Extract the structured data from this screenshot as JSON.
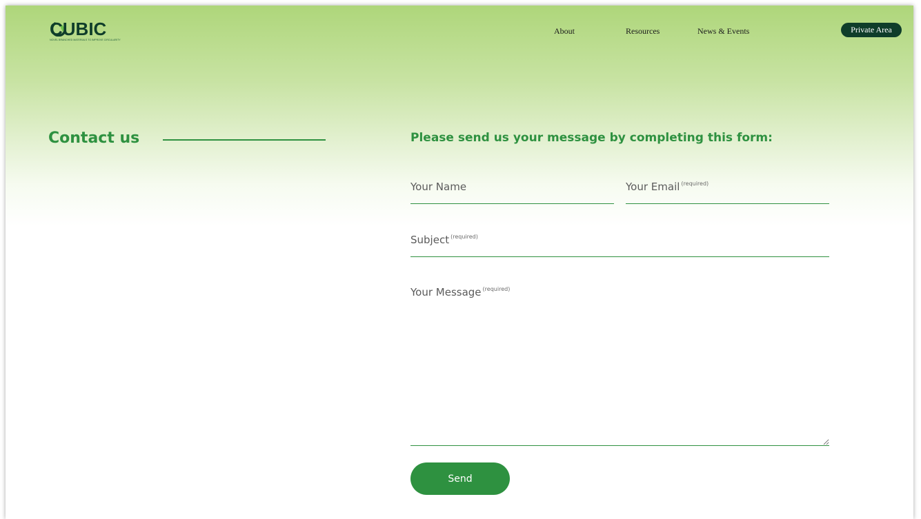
{
  "brand": {
    "name": "CUBIC",
    "tagline": "NOVEL BRANCHED MATERIALS TO IMPROVE CIRCULARITY",
    "colors": {
      "dark": "#0f3d2a",
      "accent": "#2e9140",
      "gradient_top": "#aed67a"
    }
  },
  "nav": {
    "items": [
      {
        "label": "About"
      },
      {
        "label": "Resources"
      },
      {
        "label": "News & Events"
      }
    ],
    "private_area_label": "Private Area"
  },
  "contact": {
    "title": "Contact us",
    "form_heading": "Please send us your message by completing this form:"
  },
  "form": {
    "name": {
      "label": "Your Name",
      "value": ""
    },
    "email": {
      "label": "Your Email",
      "note": "(required)",
      "value": ""
    },
    "subject": {
      "label": "Subject",
      "note": "(required)",
      "value": ""
    },
    "message": {
      "label": "Your Message",
      "note": "(required)",
      "value": ""
    },
    "send_label": "Send"
  }
}
